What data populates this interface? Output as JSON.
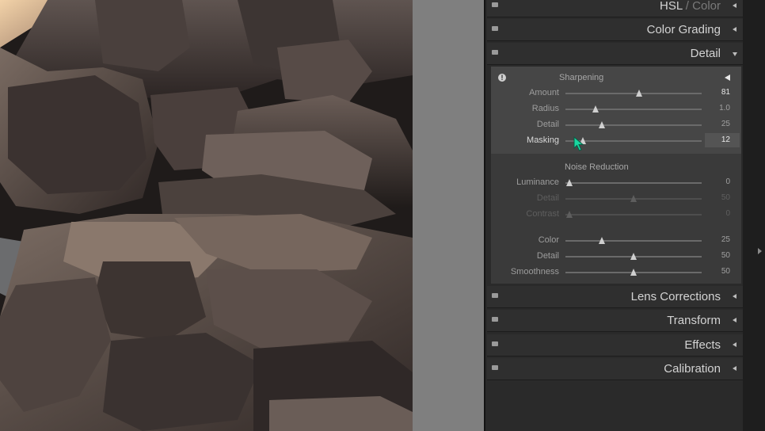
{
  "panel": {
    "sections_top": [
      {
        "title": "HSL",
        "title_dim": " / Color",
        "expanded": false
      },
      {
        "title": "Color Grading",
        "title_dim": "",
        "expanded": false
      },
      {
        "title": "Detail",
        "title_dim": "",
        "expanded": true
      }
    ],
    "sections_bottom": [
      {
        "title": "Lens Corrections",
        "title_dim": "",
        "expanded": false
      },
      {
        "title": "Transform",
        "title_dim": "",
        "expanded": false
      },
      {
        "title": "Effects",
        "title_dim": "",
        "expanded": false
      },
      {
        "title": "Calibration",
        "title_dim": "",
        "expanded": false
      }
    ]
  },
  "detail": {
    "sharpening": {
      "heading": "Sharpening",
      "sliders": [
        {
          "label": "Amount",
          "value": "81",
          "fraction": 0.54
        },
        {
          "label": "Radius",
          "value": "1.0",
          "fraction": 0.22
        },
        {
          "label": "Detail",
          "value": "25",
          "fraction": 0.27
        },
        {
          "label": "Masking",
          "value": "12",
          "fraction": 0.13
        }
      ]
    },
    "noise_reduction": {
      "heading": "Noise Reduction",
      "sliders": [
        {
          "label": "Luminance",
          "value": "0",
          "fraction": 0.03,
          "enabled": true
        },
        {
          "label": "Detail",
          "value": "50",
          "fraction": 0.5,
          "enabled": false
        },
        {
          "label": "Contrast",
          "value": "0",
          "fraction": 0.03,
          "enabled": false
        },
        {
          "label": "Color",
          "value": "25",
          "fraction": 0.27,
          "enabled": true
        },
        {
          "label": "Detail",
          "value": "50",
          "fraction": 0.5,
          "enabled": true
        },
        {
          "label": "Smoothness",
          "value": "50",
          "fraction": 0.5,
          "enabled": true
        }
      ]
    }
  },
  "colors": {
    "cursor": "#19d6a0",
    "panel_bg": "#2a2a2a",
    "active_box": "#464646"
  }
}
